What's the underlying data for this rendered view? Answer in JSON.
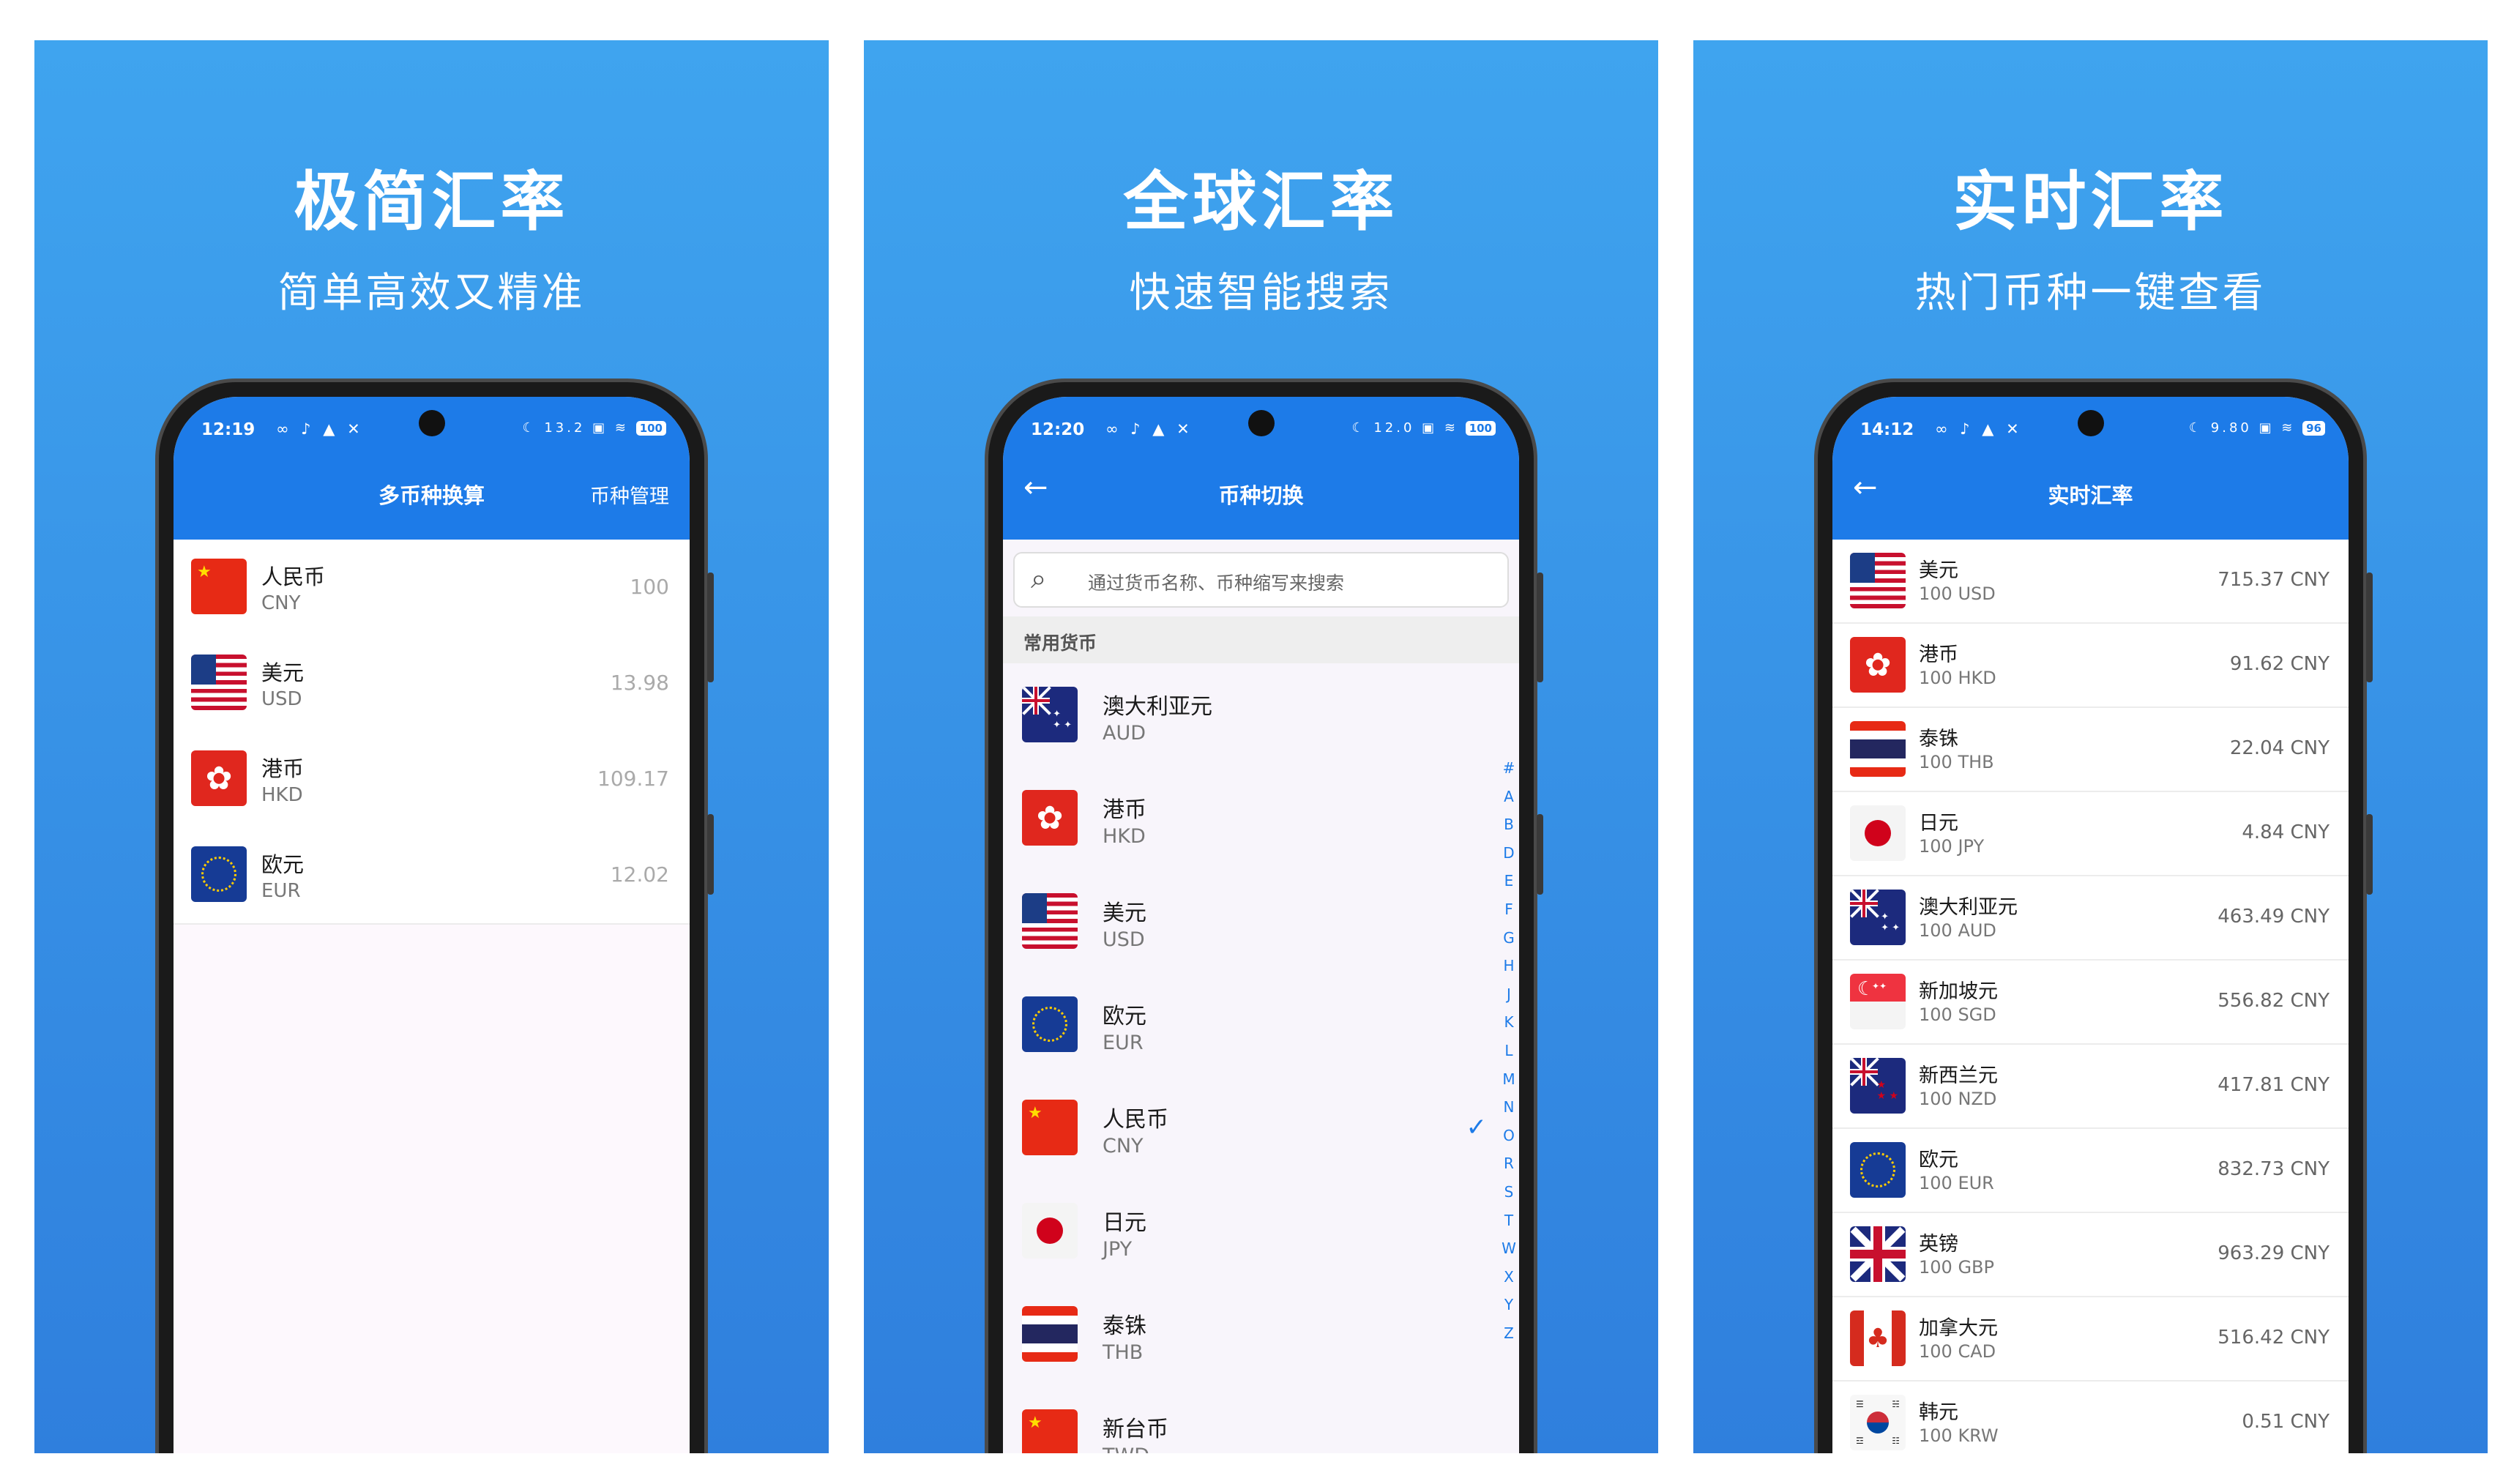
{
  "panels": [
    {
      "headline": "极简汇率",
      "subheadline": "简单高效又精准",
      "status": {
        "time": "12:19",
        "left_icons": "∞ ♪ ▲ ✕",
        "right_icons": "☾ 13.2 ▣ ≋",
        "battery": "100"
      },
      "appbar": {
        "title": "多币种换算",
        "action": "币种管理"
      },
      "rows": [
        {
          "flag": "cn",
          "name": "人民币",
          "code": "CNY",
          "value": "100"
        },
        {
          "flag": "us",
          "name": "美元",
          "code": "USD",
          "value": "13.98"
        },
        {
          "flag": "hk",
          "name": "港币",
          "code": "HKD",
          "value": "109.17"
        },
        {
          "flag": "eu",
          "name": "欧元",
          "code": "EUR",
          "value": "12.02"
        }
      ]
    },
    {
      "headline": "全球汇率",
      "subheadline": "快速智能搜索",
      "status": {
        "time": "12:20",
        "left_icons": "∞ ♪ ▲ ✕",
        "right_icons": "☾ 12.0 ▣ ≋",
        "battery": "100"
      },
      "appbar": {
        "title": "币种切换",
        "back": "←"
      },
      "search": {
        "placeholder": "通过货币名称、币种缩写来搜索"
      },
      "section_header": "常用货币",
      "rows": [
        {
          "flag": "au",
          "name": "澳大利亚元",
          "code": "AUD"
        },
        {
          "flag": "hk",
          "name": "港币",
          "code": "HKD"
        },
        {
          "flag": "us",
          "name": "美元",
          "code": "USD"
        },
        {
          "flag": "eu",
          "name": "欧元",
          "code": "EUR"
        },
        {
          "flag": "cn",
          "name": "人民币",
          "code": "CNY",
          "selected": true
        },
        {
          "flag": "jp",
          "name": "日元",
          "code": "JPY"
        },
        {
          "flag": "th",
          "name": "泰铢",
          "code": "THB"
        },
        {
          "flag": "cn",
          "name": "新台币",
          "code": "TWD"
        }
      ],
      "index_letters": [
        "#",
        "A",
        "B",
        "D",
        "E",
        "F",
        "G",
        "H",
        "J",
        "K",
        "L",
        "M",
        "N",
        "O",
        "R",
        "S",
        "T",
        "W",
        "X",
        "Y",
        "Z"
      ]
    },
    {
      "headline": "实时汇率",
      "subheadline": "热门币种一键查看",
      "status": {
        "time": "14:12",
        "left_icons": "∞ ♪ ▲ ✕",
        "right_icons": "☾ 9.80 ▣ ≋",
        "battery": "96"
      },
      "appbar": {
        "title": "实时汇率",
        "back": "←"
      },
      "rows": [
        {
          "flag": "us",
          "name": "美元",
          "code": "100 USD",
          "value": "715.37 CNY"
        },
        {
          "flag": "hk",
          "name": "港币",
          "code": "100 HKD",
          "value": "91.62 CNY"
        },
        {
          "flag": "th",
          "name": "泰铢",
          "code": "100 THB",
          "value": "22.04 CNY"
        },
        {
          "flag": "jp",
          "name": "日元",
          "code": "100 JPY",
          "value": "4.84 CNY"
        },
        {
          "flag": "au",
          "name": "澳大利亚元",
          "code": "100 AUD",
          "value": "463.49 CNY"
        },
        {
          "flag": "sg",
          "name": "新加坡元",
          "code": "100 SGD",
          "value": "556.82 CNY"
        },
        {
          "flag": "nz",
          "name": "新西兰元",
          "code": "100 NZD",
          "value": "417.81 CNY"
        },
        {
          "flag": "eu",
          "name": "欧元",
          "code": "100 EUR",
          "value": "832.73 CNY"
        },
        {
          "flag": "gb",
          "name": "英镑",
          "code": "100 GBP",
          "value": "963.29 CNY"
        },
        {
          "flag": "ca",
          "name": "加拿大元",
          "code": "100 CAD",
          "value": "516.42 CNY"
        },
        {
          "flag": "kr",
          "name": "韩元",
          "code": "100 KRW",
          "value": "0.51 CNY"
        }
      ]
    }
  ],
  "colors": {
    "panel_top": "#3fa4ef",
    "panel_bottom": "#2f7fdd",
    "appbar": "#1d7be8",
    "accent": "#1d7be8"
  }
}
